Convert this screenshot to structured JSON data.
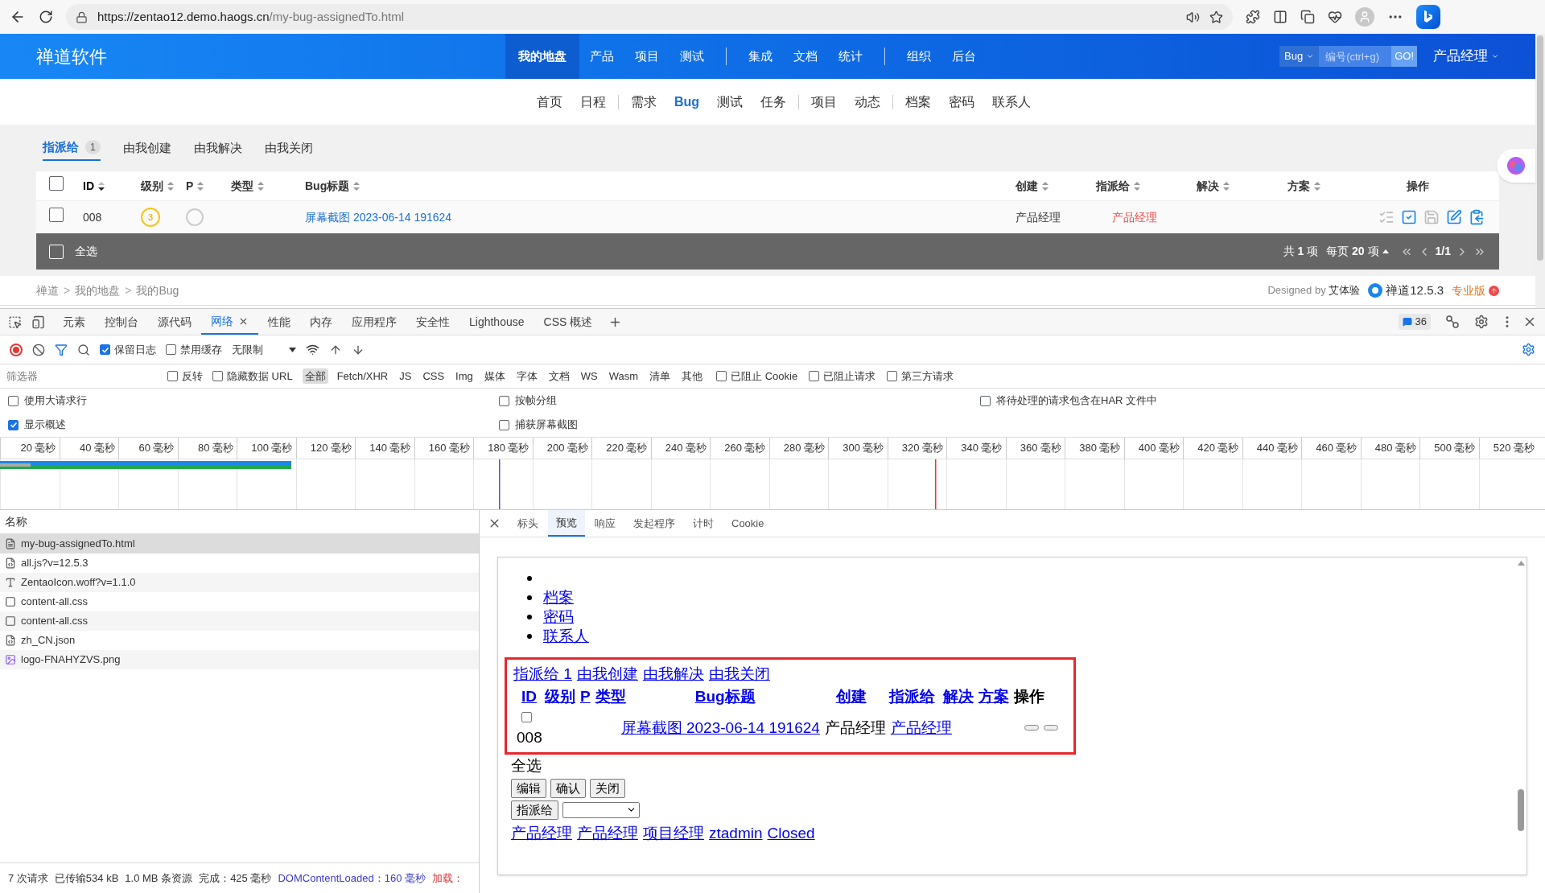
{
  "browser": {
    "url_host": "https://zentao12.demo.haogs.cn",
    "url_path": "/my-bug-assignedTo.html"
  },
  "app": {
    "logo": "禅道软件",
    "main_nav": [
      {
        "label": "我的地盘",
        "selected": true,
        "divider_after": false
      },
      {
        "label": "产品",
        "selected": false,
        "divider_after": false
      },
      {
        "label": "项目",
        "selected": false,
        "divider_after": false
      },
      {
        "label": "测试",
        "selected": false,
        "divider_after": true
      },
      {
        "label": "集成",
        "selected": false,
        "divider_after": false
      },
      {
        "label": "文档",
        "selected": false,
        "divider_after": false
      },
      {
        "label": "统计",
        "selected": false,
        "divider_after": true
      },
      {
        "label": "组织",
        "selected": false,
        "divider_after": false
      },
      {
        "label": "后台",
        "selected": false,
        "divider_after": false
      }
    ],
    "search": {
      "type": "Bug",
      "placeholder": "编号(ctrl+g)",
      "button": "GO!"
    },
    "user": "产品经理",
    "sub_nav": [
      {
        "label": "首页",
        "selected": false,
        "divider_after": false
      },
      {
        "label": "日程",
        "selected": false,
        "divider_after": true
      },
      {
        "label": "需求",
        "selected": false,
        "divider_after": false
      },
      {
        "label": "Bug",
        "selected": true,
        "divider_after": false
      },
      {
        "label": "测试",
        "selected": false,
        "divider_after": false
      },
      {
        "label": "任务",
        "selected": false,
        "divider_after": true
      },
      {
        "label": "项目",
        "selected": false,
        "divider_after": false
      },
      {
        "label": "动态",
        "selected": false,
        "divider_after": true
      },
      {
        "label": "档案",
        "selected": false,
        "divider_after": false
      },
      {
        "label": "密码",
        "selected": false,
        "divider_after": false
      },
      {
        "label": "联系人",
        "selected": false,
        "divider_after": false
      }
    ],
    "tabs": [
      {
        "label": "指派给",
        "count": "1",
        "selected": true
      },
      {
        "label": "由我创建",
        "selected": false
      },
      {
        "label": "由我解决",
        "selected": false
      },
      {
        "label": "由我关闭",
        "selected": false
      }
    ],
    "table": {
      "columns": [
        {
          "label": "ID",
          "sortable": true,
          "sorted": true
        },
        {
          "label": "级别",
          "sortable": true,
          "sorted": false
        },
        {
          "label": "P",
          "sortable": true,
          "sorted": false
        },
        {
          "label": "类型",
          "sortable": true,
          "sorted": false
        },
        {
          "label": "Bug标题",
          "sortable": true,
          "sorted": false
        },
        {
          "label": "创建",
          "sortable": true,
          "sorted": false
        },
        {
          "label": "指派给",
          "sortable": true,
          "sorted": false
        },
        {
          "label": "解决",
          "sortable": true,
          "sorted": false
        },
        {
          "label": "方案",
          "sortable": true,
          "sorted": false
        },
        {
          "label": "操作",
          "sortable": false,
          "sorted": false
        }
      ],
      "header_checked": false,
      "rows": [
        {
          "checked": false,
          "id": "008",
          "severity": "3",
          "title": "屏幕截图 2023-06-14 191624",
          "creator": "产品经理",
          "assigned_to": "产品经理"
        }
      ],
      "select_all": {
        "label": "全选",
        "checked": false
      },
      "summary": "共 **1** 项",
      "per_page": "每页 **20** 项",
      "page": "1/1"
    },
    "breadcrumb": [
      {
        "label": "禅道"
      },
      {
        "separator": ">",
        "label": "我的地盘"
      },
      {
        "separator": ">",
        "label": "我的Bug"
      }
    ],
    "footer": {
      "designed_by": "Designed by",
      "designer": "艾体验",
      "version": "禅道12.5.3",
      "edition": "专业版"
    }
  },
  "devtools": {
    "tabs": [
      {
        "label": "元素",
        "selected": false,
        "closable": false
      },
      {
        "label": "控制台",
        "selected": false,
        "closable": false
      },
      {
        "label": "源代码",
        "selected": false,
        "closable": false
      },
      {
        "label": "网络",
        "selected": true,
        "closable": true
      },
      {
        "label": "性能",
        "selected": false,
        "closable": false
      },
      {
        "label": "内存",
        "selected": false,
        "closable": false
      },
      {
        "label": "应用程序",
        "selected": false,
        "closable": false
      },
      {
        "label": "安全性",
        "selected": false,
        "closable": false
      },
      {
        "label": "Lighthouse",
        "selected": false,
        "closable": false
      },
      {
        "label": "CSS 概述",
        "selected": false,
        "closable": false
      }
    ],
    "issues_count": "36",
    "preserve_log": {
      "label": "保留日志",
      "checked": true
    },
    "disable_cache": {
      "label": "禁用缓存",
      "checked": false
    },
    "throttling": "无限制",
    "filter_placeholder": "筛选器",
    "filter_checks": [
      {
        "label": "反转",
        "checked": false
      },
      {
        "label": "隐藏数据 URL",
        "checked": false
      }
    ],
    "types": [
      {
        "label": "全部",
        "selected": true
      },
      {
        "label": "Fetch/XHR",
        "selected": false
      },
      {
        "label": "JS",
        "selected": false
      },
      {
        "label": "CSS",
        "selected": false
      },
      {
        "label": "Img",
        "selected": false
      },
      {
        "label": "媒体",
        "selected": false
      },
      {
        "label": "字体",
        "selected": false
      },
      {
        "label": "文档",
        "selected": false
      },
      {
        "label": "WS",
        "selected": false
      },
      {
        "label": "Wasm",
        "selected": false
      },
      {
        "label": "清单",
        "selected": false
      },
      {
        "label": "其他",
        "selected": false
      }
    ],
    "block_checks": [
      {
        "label": "已阻止 Cookie",
        "checked": false
      },
      {
        "label": "已阻止请求",
        "checked": false
      },
      {
        "label": "第三方请求",
        "checked": false
      }
    ],
    "options": [
      {
        "label": "使用大请求行",
        "checked": false
      },
      {
        "label": "按帧分组",
        "checked": false
      },
      {
        "label": "将待处理的请求包含在HAR 文件中",
        "checked": false
      },
      {
        "label": "显示概述",
        "checked": true
      },
      {
        "label": "捕获屏幕截图",
        "checked": false
      }
    ],
    "ticks": [
      "20 毫秒",
      "40 毫秒",
      "60 毫秒",
      "80 毫秒",
      "100 毫秒",
      "120 毫秒",
      "140 毫秒",
      "160 毫秒",
      "180 毫秒",
      "200 毫秒",
      "220 毫秒",
      "240 毫秒",
      "260 毫秒",
      "280 毫秒",
      "300 毫秒",
      "320 毫秒",
      "340 毫秒",
      "360 毫秒",
      "380 毫秒",
      "400 毫秒",
      "420 毫秒",
      "440 毫秒",
      "460 毫秒",
      "480 毫秒",
      "500 毫秒",
      "520 毫秒"
    ],
    "name_header": "名称",
    "requests": [
      {
        "name": "my-bug-assignedTo.html",
        "kind": "document",
        "selected": true
      },
      {
        "name": "all.js?v=12.5.3",
        "kind": "script",
        "selected": false
      },
      {
        "name": "ZentaoIcon.woff?v=1.1.0",
        "kind": "font",
        "selected": false
      },
      {
        "name": "content-all.css",
        "kind": "stylesheet",
        "selected": false
      },
      {
        "name": "content-all.css",
        "kind": "stylesheet",
        "selected": false
      },
      {
        "name": "zh_CN.json",
        "kind": "script",
        "selected": false
      },
      {
        "name": "logo-FNAHYZVS.png",
        "kind": "image",
        "selected": false
      }
    ],
    "status": {
      "requests": "7 次请求",
      "transferred": "已传输534 kB",
      "resources": "1.0 MB 条资源",
      "finish": "完成：425 毫秒",
      "dom_loaded": "DOMContentLoaded：160 毫秒",
      "load": "加载："
    },
    "detail_tabs": [
      {
        "label": "标头",
        "selected": false
      },
      {
        "label": "预览",
        "selected": true
      },
      {
        "label": "响应",
        "selected": false
      },
      {
        "label": "发起程序",
        "selected": false
      },
      {
        "label": "计时",
        "selected": false
      },
      {
        "label": "Cookie",
        "selected": false
      }
    ],
    "preview": {
      "list": [
        "档案",
        "密码",
        "联系人"
      ],
      "tabs": [
        "指派给 1",
        "由我创建",
        "由我解决",
        "由我关闭"
      ],
      "headers": [
        {
          "label": "ID",
          "link": true
        },
        {
          "label": "级别",
          "link": true
        },
        {
          "label": "P",
          "link": true
        },
        {
          "label": "类型",
          "link": true
        },
        {
          "label": "Bug标题",
          "link": true
        },
        {
          "label": "创建",
          "link": true
        },
        {
          "label": "指派给",
          "link": true
        },
        {
          "label": "解决",
          "link": true
        },
        {
          "label": "方案",
          "link": true
        },
        {
          "label": "操作",
          "link": false
        }
      ],
      "row": {
        "checked": false,
        "id": "008",
        "title": "屏幕截图 2023-06-14 191624",
        "creator": "产品经理",
        "assigned_to": "产品经理"
      },
      "select_all": "全选",
      "buttons": [
        "编辑",
        "确认",
        "关闭"
      ],
      "assign_button": "指派给",
      "links": [
        "产品经理",
        "产品经理",
        "项目经理",
        "ztadmin",
        "Closed"
      ]
    }
  }
}
